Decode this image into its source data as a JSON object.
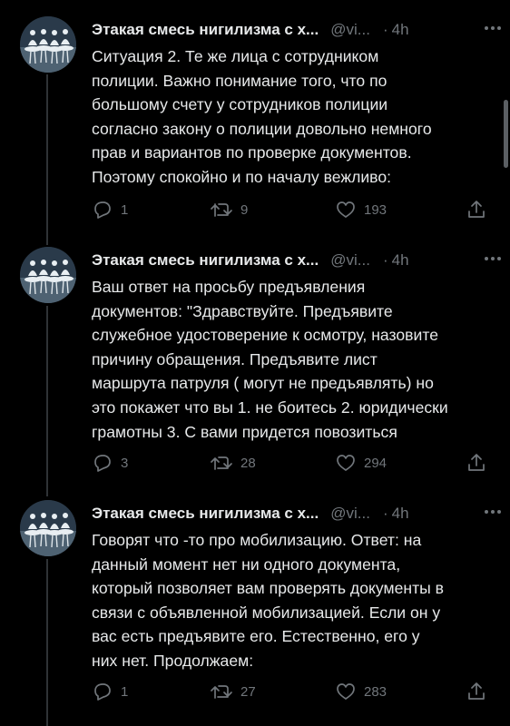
{
  "tweets": [
    {
      "name": "Этакая смесь нигилизма с х...",
      "handle": "@vi...",
      "dot": "·",
      "time": "4h",
      "text": "Ситуация 2. Те же лица с сотрудником\nполиции. Важно понимание того, что по\nбольшому счету у сотрудников полиции\nсогласно закону о полиции довольно немного\nправ и вариантов по проверке документов.\nПоэтому спокойно и по началу вежливо:",
      "replies": "1",
      "retweets": "9",
      "likes": "193"
    },
    {
      "name": "Этакая смесь нигилизма с х...",
      "handle": "@vi...",
      "dot": "·",
      "time": "4h",
      "text": "Ваш ответ на просьбу предъявления\nдокументов: \"Здравствуйте. Предъявите\nслужебное удостоверение к осмотру, назовите\nпричину обращения. Предъявите лист\nмаршрута патруля ( могут не предъявлять) но\nэто покажет что вы 1. не боитесь 2. юридически\nграмотны 3. С вами придется повозиться",
      "replies": "3",
      "retweets": "28",
      "likes": "294"
    },
    {
      "name": "Этакая смесь нигилизма с х...",
      "handle": "@vi...",
      "dot": "·",
      "time": "4h",
      "text": "Говорят что -то про мобилизацию. Ответ: на\nданный момент нет ни одного документа,\nкоторый позволяет вам проверять документы в\nсвязи с объявленной мобилизацией. Если он у\nвас есть предъявите его. Естественно, его у\nних нет. Продолжаем:",
      "replies": "1",
      "retweets": "27",
      "likes": "283"
    }
  ],
  "icons": {
    "more": "more-horizontal-icon",
    "reply": "reply-icon",
    "retweet": "retweet-icon",
    "like": "heart-icon",
    "share": "share-icon"
  },
  "colors": {
    "background": "#000000",
    "text": "#e7e9ea",
    "secondary": "#71767b",
    "thread_line": "#2f3336"
  }
}
